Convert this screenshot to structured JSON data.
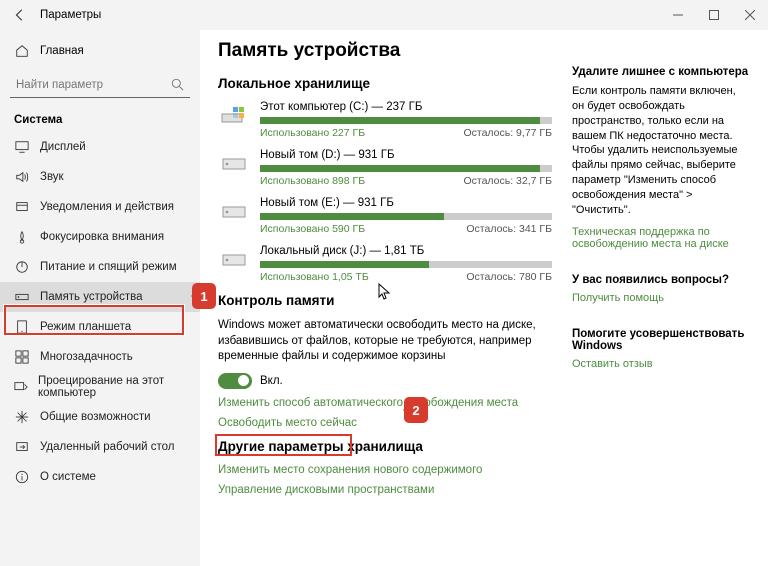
{
  "titlebar": {
    "title": "Параметры"
  },
  "sidebar": {
    "home": "Главная",
    "search_placeholder": "Найти параметр",
    "category": "Система",
    "items": [
      {
        "label": "Дисплей"
      },
      {
        "label": "Звук"
      },
      {
        "label": "Уведомления и действия"
      },
      {
        "label": "Фокусировка внимания"
      },
      {
        "label": "Питание и спящий режим"
      },
      {
        "label": "Память устройства"
      },
      {
        "label": "Режим планшета"
      },
      {
        "label": "Многозадачность"
      },
      {
        "label": "Проецирование на этот компьютер"
      },
      {
        "label": "Общие возможности"
      },
      {
        "label": "Удаленный рабочий стол"
      },
      {
        "label": "О системе"
      }
    ]
  },
  "page": {
    "title": "Память устройства",
    "local_header": "Локальное хранилище",
    "drives": [
      {
        "name": "Этот компьютер (C:) — 237 ГБ",
        "used": "Использовано 227 ГБ",
        "free": "Осталось: 9,77 ГБ",
        "pct": 96
      },
      {
        "name": "Новый том (D:) — 931 ГБ",
        "used": "Использовано 898 ГБ",
        "free": "Осталось: 32,7 ГБ",
        "pct": 96
      },
      {
        "name": "Новый том (E:) — 931 ГБ",
        "used": "Использовано 590 ГБ",
        "free": "Осталось: 341 ГБ",
        "pct": 63
      },
      {
        "name": "Локальный диск (J:) — 1,81 ТБ",
        "used": "Использовано 1,05 ТБ",
        "free": "Осталось: 780 ГБ",
        "pct": 58
      }
    ],
    "sense_header": "Контроль памяти",
    "sense_text": "Windows может автоматически освободить место на диске, избавившись от файлов, которые не требуются, например временные файлы и содержимое корзины",
    "toggle_label": "Вкл.",
    "link_change": "Изменить способ автоматического освобождения места",
    "link_free": "Освободить место сейчас",
    "other_header": "Другие параметры хранилища",
    "link_save": "Изменить место сохранения нового содержимого",
    "link_spaces": "Управление дисковыми пространствами"
  },
  "aside": {
    "t1": "Удалите лишнее с компьютера",
    "p1": "Если контроль памяти включен, он будет освобождать пространство, только если на вашем ПК недостаточно места. Чтобы удалить неиспользуемые файлы прямо сейчас, выберите параметр \"Изменить способ освобождения места\" > \"Очистить\".",
    "l1": "Техническая поддержка по освобождению места на диске",
    "t2": "У вас появились вопросы?",
    "l2": "Получить помощь",
    "t3": "Помогите усовершенствовать Windows",
    "l3": "Оставить отзыв"
  },
  "callouts": {
    "c1": "1",
    "c2": "2"
  }
}
